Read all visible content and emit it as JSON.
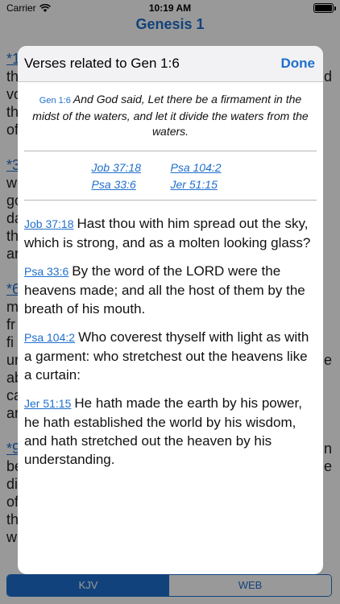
{
  "status_bar": {
    "carrier": "Carrier",
    "time": "10:19 AM"
  },
  "nav": {
    "title": "Genesis 1"
  },
  "background": {
    "rows": [
      {
        "left": "*1",
        "left_link": true,
        "right": ""
      },
      {
        "left": "th",
        "left_link": false,
        "right": "d"
      },
      {
        "left": "vo",
        "left_link": false,
        "right": ""
      },
      {
        "left": "th",
        "left_link": false,
        "right": ""
      },
      {
        "left": "of",
        "left_link": false,
        "right": ""
      },
      {
        "left": "",
        "left_link": false,
        "right": ""
      },
      {
        "left": "*3",
        "left_link": true,
        "right": ""
      },
      {
        "left": "w",
        "left_link": false,
        "right": ""
      },
      {
        "left": "go",
        "left_link": false,
        "right": ""
      },
      {
        "left": "da",
        "left_link": false,
        "right": ""
      },
      {
        "left": "th",
        "left_link": false,
        "right": ""
      },
      {
        "left": "ar",
        "left_link": false,
        "right": ""
      },
      {
        "left": "",
        "left_link": false,
        "right": ""
      },
      {
        "left": "*6",
        "left_link": true,
        "right": ""
      },
      {
        "left": "m",
        "left_link": false,
        "right": ""
      },
      {
        "left": "fr",
        "left_link": false,
        "right": ""
      },
      {
        "left": "fi",
        "left_link": false,
        "right": ""
      },
      {
        "left": "ur",
        "left_link": false,
        "right": "e"
      },
      {
        "left": "ab",
        "left_link": false,
        "right": ""
      },
      {
        "left": "ca",
        "left_link": false,
        "right": ""
      },
      {
        "left": "ar",
        "left_link": false,
        "right": ""
      },
      {
        "left": "",
        "left_link": false,
        "right": ""
      },
      {
        "left": "*9",
        "left_link": true,
        "right": "n"
      },
      {
        "left": "be",
        "left_link": false,
        "right": "e"
      },
      {
        "left": "di",
        "left_link": false,
        "right": ""
      },
      {
        "left": "of",
        "left_link": false,
        "right": ""
      },
      {
        "left": "th",
        "left_link": false,
        "right": ""
      },
      {
        "left": "wi",
        "left_link": false,
        "right": ""
      }
    ]
  },
  "modal": {
    "title": "Verses related to Gen 1:6",
    "done_label": "Done",
    "ref_label": "Gen 1:6",
    "ref_text": "And God said, Let there be a firmament in the midst of the waters, and let it divide the waters from the waters.",
    "xrefs": [
      {
        "label": "Job 37:18"
      },
      {
        "label": "Psa 104:2"
      },
      {
        "label": "Psa 33:6"
      },
      {
        "label": "Jer 51:15"
      }
    ],
    "verses": [
      {
        "ref": "Job 37:18",
        "text": "Hast thou with him spread out the sky, which is strong, and as a molten looking glass?"
      },
      {
        "ref": "Psa 33:6",
        "text": "By the word of the LORD were the heavens made; and all the host of them by the breath of his mouth."
      },
      {
        "ref": "Psa 104:2",
        "text": "Who coverest thyself with light as with a garment: who stretchest out the heavens like a curtain:"
      },
      {
        "ref": "Jer 51:15",
        "text": "He hath made the earth by his power, he hath established the world by his wisdom, and hath stretched out the heaven by his understanding."
      }
    ]
  },
  "tabs": [
    {
      "label": "KJV",
      "active": true
    },
    {
      "label": "WEB",
      "active": false
    }
  ],
  "colors": {
    "accent": "#1f6fcd",
    "overlay": "rgba(0,0,0,0.40)"
  }
}
